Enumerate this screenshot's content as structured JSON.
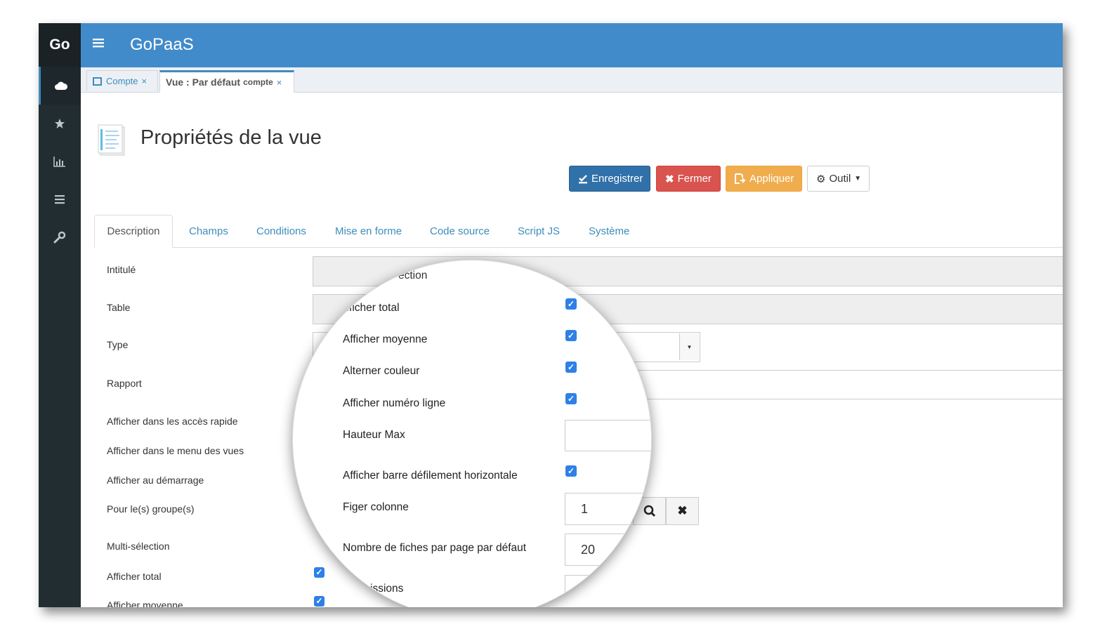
{
  "brand": "Go",
  "app_title": "GoPaaS",
  "sidebar": {
    "icons": [
      "cloud-icon",
      "star-icon",
      "bar-chart-icon",
      "list-icon",
      "wrench-icon"
    ]
  },
  "doc_tabs": [
    {
      "label": "Compte",
      "close": "×"
    },
    {
      "label": "Vue : Par défaut",
      "sub": "compte",
      "close": "×"
    }
  ],
  "page": {
    "title": "Propriétés de la vue"
  },
  "toolbar": {
    "save_label": "Enregistrer",
    "close_label": "Fermer",
    "apply_label": "Appliquer",
    "tool_label": "Outil"
  },
  "form_tabs": [
    "Description",
    "Champs",
    "Conditions",
    "Mise en forme",
    "Code source",
    "Script JS",
    "Système"
  ],
  "form_labels": [
    "Intitulé",
    "Table",
    "Type",
    "Rapport",
    "Afficher dans les accès rapide",
    "Afficher dans le menu des vues",
    "Afficher au démarrage",
    "Pour le(s) groupe(s)",
    "Multi-sélection",
    "Afficher total",
    "Afficher moyenne"
  ],
  "magnifier": {
    "top_partial": "ection",
    "rows": [
      {
        "label": "fficher total",
        "checked": true
      },
      {
        "label": "Afficher moyenne",
        "checked": true
      },
      {
        "label": "Alterner couleur",
        "checked": true
      },
      {
        "label": "Afficher numéro ligne",
        "checked": true
      },
      {
        "label": "Hauteur Max",
        "value": ""
      },
      {
        "label": "Afficher barre défilement horizontale",
        "checked": true
      },
      {
        "label": "Figer colonne",
        "value": "1"
      },
      {
        "label": "Nombre de fiches par page par défaut",
        "value": "20"
      }
    ],
    "bottom_partial": "issions"
  },
  "colors": {
    "topbar": "#428bca",
    "sidebar": "#222d32",
    "primary": "#3071a9",
    "danger": "#d9534f",
    "warning": "#f0ad4e",
    "checkbox": "#2f80e6"
  }
}
